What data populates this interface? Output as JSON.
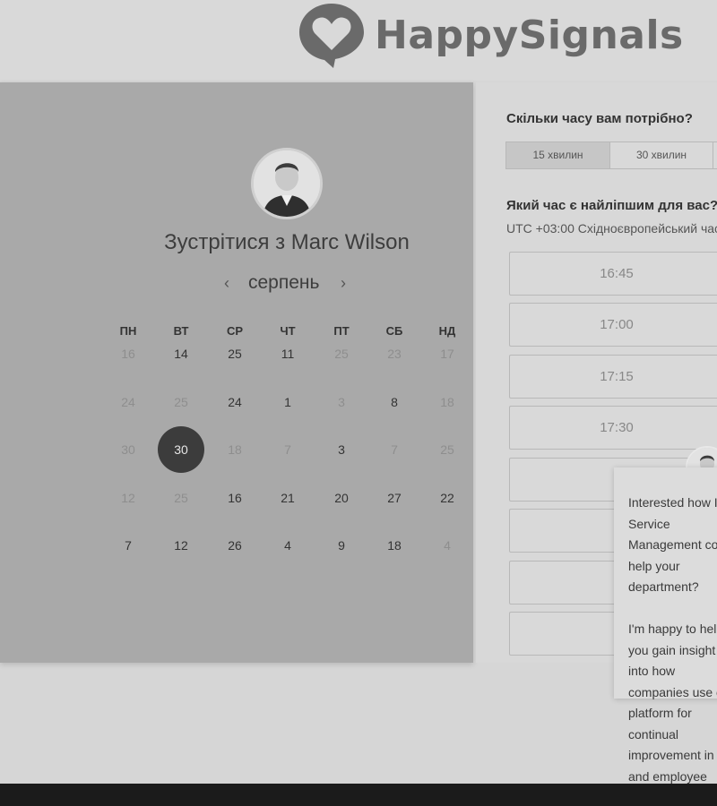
{
  "brand": {
    "name": "HappySignals"
  },
  "calendar": {
    "title": "Зустрітися з Marc Wilson",
    "month": "серпень",
    "weekdays": [
      "ПН",
      "ВТ",
      "СР",
      "ЧТ",
      "ПТ",
      "СБ",
      "НД"
    ],
    "weeks": [
      [
        "16",
        "14",
        "25",
        "11",
        "25",
        "23",
        "17"
      ],
      [
        "24",
        "25",
        "24",
        "1",
        "3",
        "8",
        "18"
      ],
      [
        "30",
        "30",
        "18",
        "7",
        "3",
        "7",
        "25"
      ],
      [
        "12",
        "25",
        "16",
        "21",
        "20",
        "27",
        "22"
      ],
      [
        "7",
        "12",
        "26",
        "4",
        "9",
        "18",
        "4"
      ]
    ],
    "selected_day": "30"
  },
  "booking": {
    "duration_question": "Скільки часу вам потрібно?",
    "durations": [
      "15 хвилин",
      "30 хвилин"
    ],
    "time_question": "Який час є найліпшим для вас?",
    "timezone": "UTC +03:00 Східноєвропейський час",
    "slots": [
      "16:45",
      "17:00",
      "17:15",
      "17:30",
      "",
      "",
      "",
      ""
    ]
  },
  "chat": {
    "message": "Interested how IT Service Management could help your department?\n\nI'm happy to help you gain insight into how companies use our platform for continual improvement in IT and employee productivity."
  },
  "colors": {
    "selected_day": "#3c3c3c",
    "panel_left": "#a9a9a9",
    "panel_right": "#d8d8d8"
  }
}
